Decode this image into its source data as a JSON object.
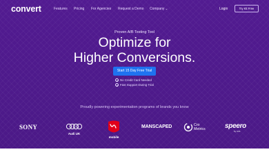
{
  "nav": {
    "logo": "convert",
    "items": [
      "Features",
      "Pricing",
      "For Agencies",
      "Request a Demo",
      "Company"
    ],
    "login": "Login",
    "try_free": "Try Kit Free"
  },
  "hero": {
    "eyebrow": "Proven A/B Testing Tool",
    "headline_line1": "Optimize for",
    "headline_line2": "Higher Conversions.",
    "cta": "Start 15 Day Free Trial",
    "checks": [
      "No Credit Card Needed",
      "Fast Support During Trial"
    ]
  },
  "brands": {
    "title": "Proudly powering experimentation programs of brands you know",
    "sony": "SONY",
    "audi": "Audi UK",
    "virgin": "mobile",
    "manscaped": "MANSCAPED",
    "cro_line1": "Cro",
    "cro_line2": "Metrics",
    "speero": "speero",
    "speero_sub": "by CXL"
  },
  "colors": {
    "hero_bg": "#4f1a8c",
    "cta_bg": "#1f72f0",
    "virgin_red": "#e1001a"
  }
}
